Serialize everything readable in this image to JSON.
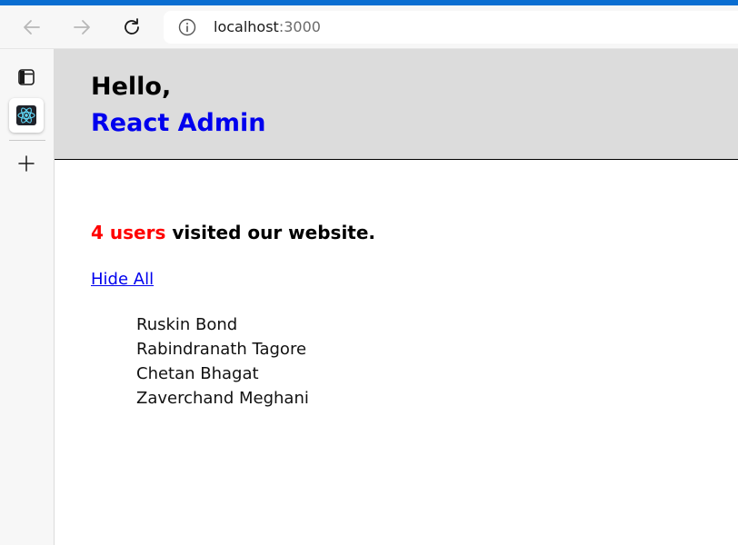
{
  "browser": {
    "address": {
      "host": "localhost",
      "port": ":3000"
    }
  },
  "header": {
    "greeting": "Hello,",
    "name": "React Admin"
  },
  "main": {
    "visit_count": "4 users",
    "visit_text": " visited our website.",
    "hide_link": "Hide All",
    "users": [
      "Ruskin Bond",
      "Rabindranath Tagore",
      "Chetan Bhagat",
      "Zaverchand Meghani"
    ]
  },
  "colors": {
    "header_bg": "#dcdcdc",
    "accent_blue": "#0000ee",
    "count_red": "#ff0000",
    "browser_topline": "#0a6ed1"
  },
  "icons": [
    "back-icon",
    "forward-icon",
    "refresh-icon",
    "info-icon",
    "tab-layout-icon",
    "react-icon",
    "plus-icon"
  ]
}
